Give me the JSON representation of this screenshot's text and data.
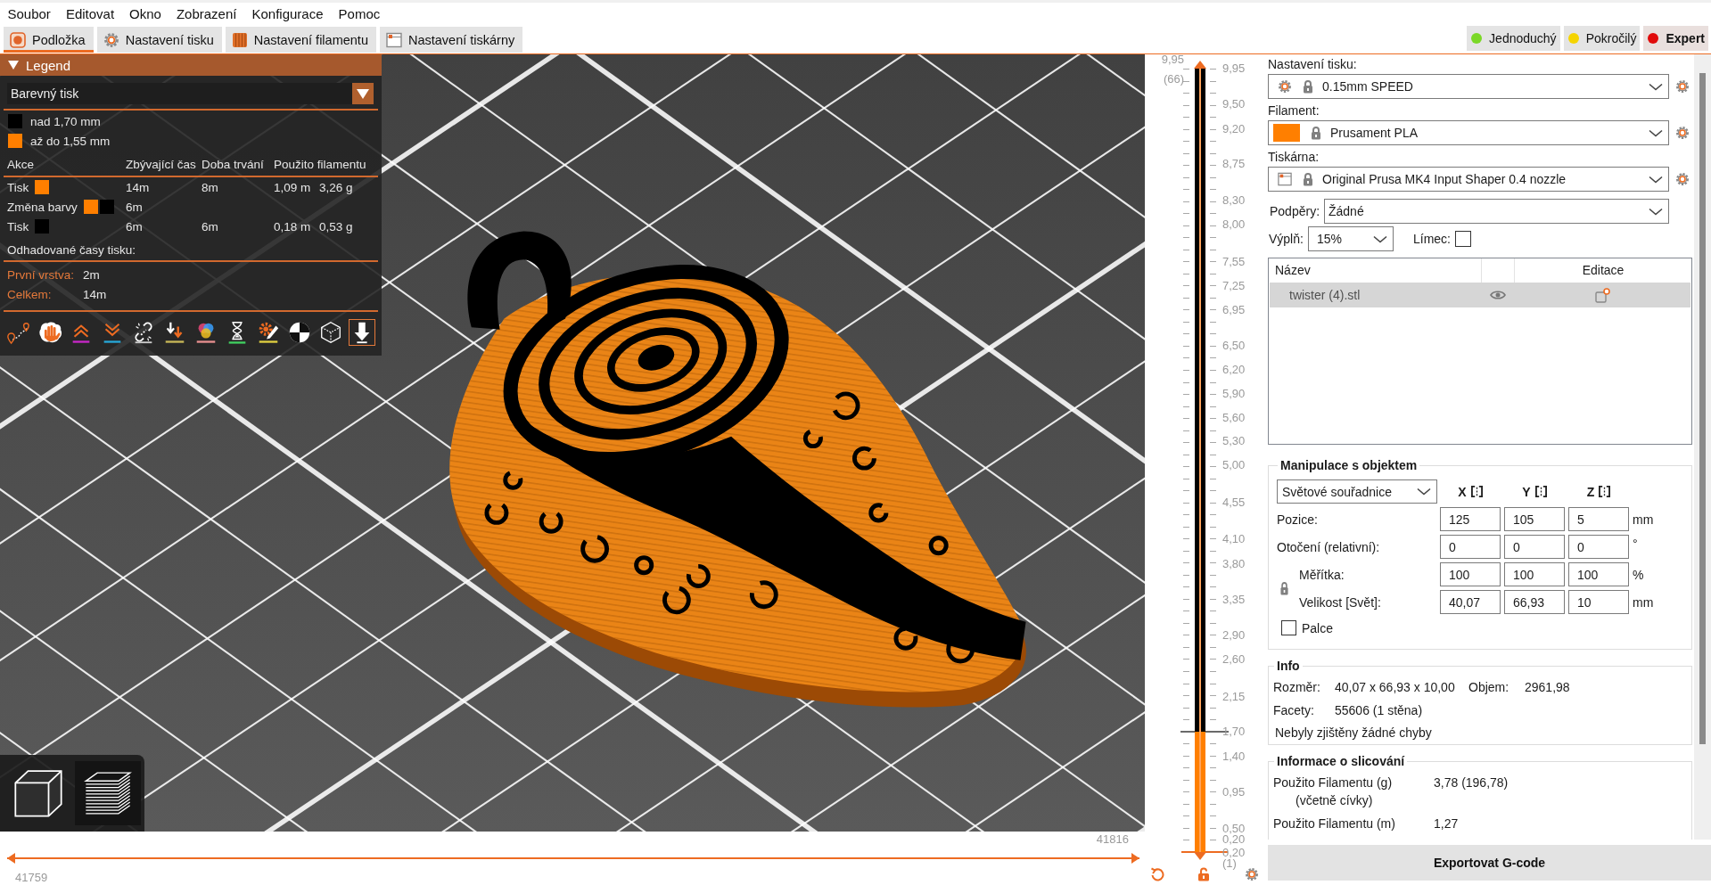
{
  "menu_bar": {
    "items": [
      "Soubor",
      "Editovat",
      "Okno",
      "Zobrazení",
      "Konfigurace",
      "Pomoc"
    ]
  },
  "tabs": [
    {
      "label": "Podložka",
      "kind": "plater",
      "selected": true
    },
    {
      "label": "Nastavení tisku",
      "kind": "print",
      "selected": false
    },
    {
      "label": "Nastavení filamentu",
      "kind": "filament",
      "selected": false
    },
    {
      "label": "Nastavení tiskárny",
      "kind": "printer",
      "selected": false
    }
  ],
  "modes": [
    {
      "label": "Jednoduchý",
      "color": "#7bd827",
      "selected": false
    },
    {
      "label": "Pokročilý",
      "color": "#f5d400",
      "selected": false
    },
    {
      "label": "Expert",
      "color": "#e10a0a",
      "selected": true
    }
  ],
  "legend": {
    "title": "Legend",
    "expanded": true,
    "view_type": "Barevný tisk",
    "ranges": [
      {
        "label": "nad 1,70 mm",
        "color": "#000000"
      },
      {
        "label": "až do 1,55 mm",
        "color": "#ff7f00"
      }
    ],
    "columns": [
      "Akce",
      "Zbývající čas",
      "Doba trvání",
      "Použito filamentu"
    ],
    "rows": [
      {
        "action": "Tisk",
        "swatches": [
          {
            "color": "#ff7f00"
          }
        ],
        "remaining": "14m",
        "duration": "8m",
        "length": "1,09 m",
        "weight": "3,26 g"
      },
      {
        "action": "Změna barvy",
        "swatches": [
          {
            "color": "#ff7f00"
          },
          {
            "color": "#000000"
          }
        ],
        "remaining": "6m"
      },
      {
        "action": "Tisk",
        "swatches": [
          {
            "color": "#000000"
          }
        ],
        "remaining": "6m",
        "duration": "6m",
        "length": "0,18 m",
        "weight": "0,53 g"
      }
    ],
    "estimates_title": "Odhadované časy tisku:",
    "estimates": [
      {
        "label": "První vrstva:",
        "value": "2m"
      },
      {
        "label": "Celkem:",
        "value": "14m"
      }
    ],
    "toolbar": [
      {
        "kind": "route",
        "selected": false
      },
      {
        "kind": "hand",
        "selected": false
      },
      {
        "kind": "up",
        "selected": false
      },
      {
        "kind": "down",
        "selected": false
      },
      {
        "kind": "link",
        "selected": false
      },
      {
        "kind": "arrows",
        "selected": false
      },
      {
        "kind": "colors",
        "selected": false
      },
      {
        "kind": "hourglass",
        "selected": false
      },
      {
        "kind": "gear",
        "selected": false
      },
      {
        "kind": "checker",
        "selected": false
      },
      {
        "kind": "cube",
        "selected": false
      },
      {
        "kind": "tool",
        "selected": true
      }
    ]
  },
  "view_toggle": [
    {
      "kind": "solid",
      "selected": false
    },
    {
      "kind": "preview",
      "selected": true
    }
  ],
  "horizontal_slider": {
    "lower": {
      "label": "41759",
      "level": 0
    },
    "upper": {
      "label": "41816",
      "level": 1
    }
  },
  "layer_slider": {
    "upper": {
      "label": "9,95",
      "layer": "(66)",
      "level": 1
    },
    "lower": {
      "label": "0,20",
      "layer": "(1)",
      "level": 0
    },
    "bands": [
      {
        "color": "#000000"
      },
      {
        "color": "#ff7f00"
      }
    ],
    "ticks": [
      {
        "label": "9,95",
        "color_change": false
      },
      {
        "label": "9,50",
        "color_change": false
      },
      {
        "label": "9,20",
        "color_change": false
      },
      {
        "label": "8,75",
        "color_change": false
      },
      {
        "label": "8,30",
        "color_change": false
      },
      {
        "label": "8,00",
        "color_change": false
      },
      {
        "label": "7,55",
        "color_change": false
      },
      {
        "label": "7,25",
        "color_change": false
      },
      {
        "label": "6,95",
        "color_change": false
      },
      {
        "label": "6,50",
        "color_change": false
      },
      {
        "label": "6,20",
        "color_change": false
      },
      {
        "label": "5,90",
        "color_change": false
      },
      {
        "label": "5,60",
        "color_change": false
      },
      {
        "label": "5,30",
        "color_change": false
      },
      {
        "label": "5,00",
        "color_change": false
      },
      {
        "label": "4,55",
        "color_change": false
      },
      {
        "label": "4,10",
        "color_change": false
      },
      {
        "label": "3,80",
        "color_change": false
      },
      {
        "label": "3,35",
        "color_change": false
      },
      {
        "label": "2,90",
        "color_change": false
      },
      {
        "label": "2,60",
        "color_change": false
      },
      {
        "label": "2,15",
        "color_change": false
      },
      {
        "label": "1,70",
        "color_change": true
      },
      {
        "label": "1,40",
        "color_change": false
      },
      {
        "label": "0,95",
        "color_change": false
      },
      {
        "label": "0,50",
        "color_change": false
      },
      {
        "label": "0,20",
        "color_change": false
      }
    ]
  },
  "sidebar": {
    "presets": [
      {
        "kind": "print",
        "label": "Nastavení tisku:",
        "value": "0.15mm SPEED"
      },
      {
        "kind": "filament",
        "label": "Filament:",
        "value": "Prusament PLA",
        "color": "#ff7f00"
      },
      {
        "kind": "printer",
        "label": "Tiskárna:",
        "value": "Original Prusa MK4 Input Shaper 0.4 nozzle"
      }
    ],
    "supports": {
      "label": "Podpěry:",
      "value": "Žádné"
    },
    "infill": {
      "label": "Výplň:",
      "value": "15%"
    },
    "brim": {
      "label": "Límec:",
      "checked": false
    },
    "object_list": {
      "columns": [
        "Název",
        "Editace"
      ],
      "rows": [
        {
          "name": "twister (4).stl",
          "selected": true
        }
      ]
    },
    "manipulation": {
      "title": "Manipulace s objektem",
      "coordinates": "Světové souřadnice",
      "axes": [
        "X",
        "Y",
        "Z"
      ],
      "rows": [
        {
          "kind": "plain",
          "label": "Pozice:",
          "values": [
            "125",
            "105",
            "5"
          ],
          "unit": "mm"
        },
        {
          "kind": "plain",
          "label": "Otočení (relativní):",
          "values": [
            "0",
            "0",
            "0"
          ],
          "unit": "°"
        },
        {
          "kind": "scale",
          "label": "Měřítka:",
          "values": [
            "100",
            "100",
            "100"
          ],
          "unit": "%"
        },
        {
          "kind": "scale",
          "label": "Velikost [Svět]:",
          "values": [
            "40,07",
            "66,93",
            "10"
          ],
          "unit": "mm"
        }
      ],
      "inches": {
        "label": "Palce",
        "checked": false
      }
    },
    "info": {
      "title": "Info",
      "size": {
        "label": "Rozměr:",
        "value": "40,07 x 66,93 x 10,00"
      },
      "volume": {
        "label": "Objem:",
        "value": "2961,98"
      },
      "facets": {
        "label": "Facety:",
        "value": "55606 (1 stěna)"
      },
      "status": "Nebyly zjištěny žádné chyby"
    },
    "slicing_info": {
      "title": "Informace o slicování",
      "rows": [
        {
          "label": "Použito Filamentu (g)",
          "note": "(včetně cívky)",
          "value": "3,78 (196,78)"
        },
        {
          "label": "Použito Filamentu (m)",
          "value": "1,27"
        }
      ]
    },
    "export_button": "Exportovat G-code"
  }
}
